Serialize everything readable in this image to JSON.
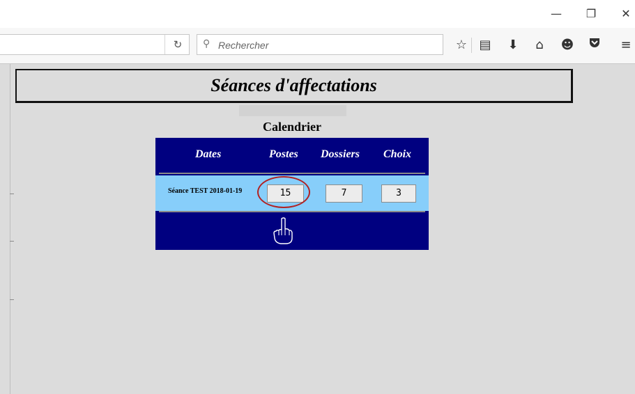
{
  "window": {
    "minimize_glyph": "—",
    "maximize_glyph": "❐",
    "close_glyph": "✕"
  },
  "toolbar": {
    "reload_icon": "C",
    "search_placeholder": "Rechercher",
    "icons": [
      "star-icon",
      "reading-list-icon",
      "download-icon",
      "home-icon",
      "chat-icon",
      "pocket-icon",
      "menu-icon"
    ]
  },
  "page": {
    "title": "Séances d'affectations",
    "calendar_title": "Calendrier",
    "table": {
      "headers": [
        "Dates",
        "Postes",
        "Dossiers",
        "Choix"
      ],
      "rows": [
        {
          "date": "Séance TEST 2018-01-19",
          "postes": "15",
          "dossiers": "7",
          "choix": "3"
        }
      ]
    }
  },
  "colors": {
    "table_bg": "#000080",
    "row_bg": "#87cefa",
    "highlight": "#b22222"
  }
}
